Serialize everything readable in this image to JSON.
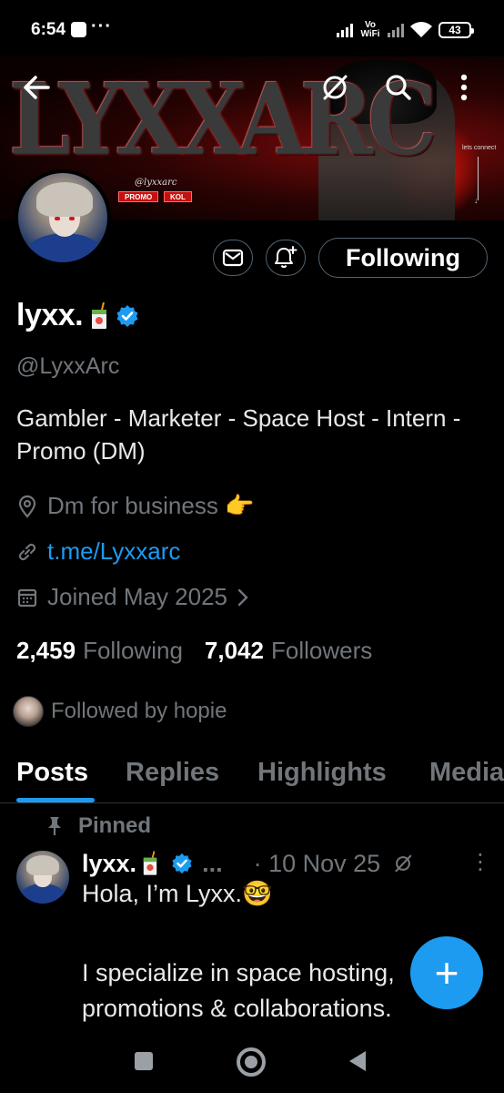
{
  "status_bar": {
    "time": "6:54",
    "dots": "···",
    "network": "Vo WiFi",
    "battery": "43"
  },
  "banner": {
    "logo_text": "LYXXARC",
    "handle": "@lyxxarc",
    "tags": [
      "PROMO",
      "KOL"
    ],
    "side_note": "lets connect"
  },
  "header": {
    "icons": [
      "back-arrow-icon",
      "grok-icon",
      "search-icon",
      "more-vertical-icon"
    ]
  },
  "profile": {
    "name": "lyxx.",
    "handle": "@LyxxArc",
    "bio": "Gambler - Marketer - Space Host - Intern - Promo (DM)",
    "location": "Dm for business 👉",
    "link": "t.me/Lyxxarc",
    "joined": "Joined May 2025",
    "following_count": "2,459",
    "following_label": "Following",
    "followers_count": "7,042",
    "followers_label": "Followers",
    "followed_by": "Followed by hopie"
  },
  "actions": {
    "follow_label": "Following"
  },
  "tabs": [
    "Posts",
    "Replies",
    "Highlights",
    "Media"
  ],
  "active_tab": "Posts",
  "post": {
    "pinned_label": "Pinned",
    "author": "lyxx.",
    "ellipsis": "...",
    "date": "· 10 Nov 25",
    "more": "⋮",
    "lines": [
      "Hola, I’m Lyxx.🤓",
      "",
      "I specialize in space hosting,",
      "promotions & collaborations."
    ]
  },
  "fab": {
    "label": "+"
  },
  "colors": {
    "accent": "#1d9bf0",
    "background": "#000000",
    "muted": "#71767b",
    "text": "#e7e9ea"
  }
}
